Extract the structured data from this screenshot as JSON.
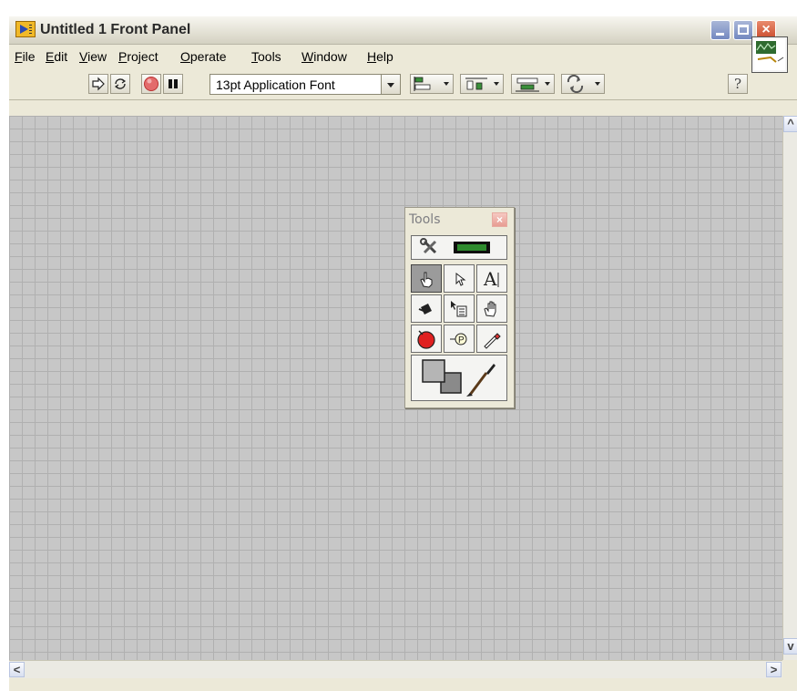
{
  "window": {
    "title": "Untitled 1 Front Panel",
    "controls": [
      "minimize",
      "maximize",
      "close"
    ]
  },
  "menubar": {
    "items": [
      {
        "label": "File",
        "mnemonic": "F",
        "rest": "ile"
      },
      {
        "label": "Edit",
        "mnemonic": "E",
        "rest": "dit"
      },
      {
        "label": "View",
        "mnemonic": "V",
        "rest": "iew"
      },
      {
        "label": "Project",
        "mnemonic": "P",
        "rest": "roject"
      },
      {
        "label": "Operate",
        "mnemonic": "O",
        "rest": "perate"
      },
      {
        "label": "Tools",
        "mnemonic": "T",
        "rest": "ools"
      },
      {
        "label": "Window",
        "mnemonic": "W",
        "rest": "indow"
      },
      {
        "label": "Help",
        "mnemonic": "H",
        "rest": "elp"
      }
    ]
  },
  "toolbar": {
    "buttons": [
      "run-icon",
      "run-continuously-icon",
      "abort-execution-icon",
      "pause-icon"
    ],
    "font_ring": "13pt Application Font",
    "dropdowns": [
      "align-objects-icon",
      "distribute-objects-icon",
      "resize-objects-icon",
      "reorder-icon"
    ],
    "help_label": "?"
  },
  "tools_palette": {
    "title": "Tools",
    "close_label": "×",
    "tools": [
      {
        "name": "automatic-tool-selection-icon"
      },
      {
        "name": "operate-value-icon",
        "selected": true
      },
      {
        "name": "position-size-select-icon"
      },
      {
        "name": "edit-text-icon"
      },
      {
        "name": "connect-wire-icon"
      },
      {
        "name": "object-shortcut-menu-icon"
      },
      {
        "name": "scroll-window-icon"
      },
      {
        "name": "set-clear-breakpoint-icon"
      },
      {
        "name": "probe-data-icon"
      },
      {
        "name": "get-color-icon"
      },
      {
        "name": "set-color-icon"
      }
    ]
  },
  "scrollbars": {
    "up_arrow": "^",
    "down_arrow": "v",
    "left_arrow": "<",
    "right_arrow": ">"
  },
  "colors": {
    "panel_background": "#c7c7c7",
    "grid_line": "#b0b0b0",
    "abort_red": "#e02020",
    "chrome": "#ece9d8"
  }
}
